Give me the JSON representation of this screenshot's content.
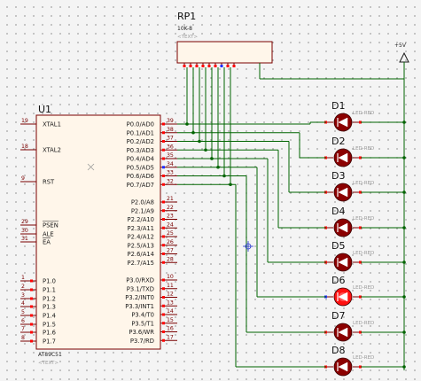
{
  "u1": {
    "ref": "U1",
    "part": "AT89C51",
    "text_placeholder": "<TEXT>",
    "left_pins": [
      {
        "num": "19",
        "label": "XTAL1"
      },
      {
        "num": "18",
        "label": "XTAL2"
      },
      {
        "num": "9",
        "label": "RST"
      },
      {
        "num": "29",
        "label": "PSEN"
      },
      {
        "num": "30",
        "label": "ALE"
      },
      {
        "num": "31",
        "label": "EA"
      },
      {
        "num": "1",
        "label": "P1.0"
      },
      {
        "num": "2",
        "label": "P1.1"
      },
      {
        "num": "3",
        "label": "P1.2"
      },
      {
        "num": "4",
        "label": "P1.3"
      },
      {
        "num": "5",
        "label": "P1.4"
      },
      {
        "num": "6",
        "label": "P1.5"
      },
      {
        "num": "7",
        "label": "P1.6"
      },
      {
        "num": "8",
        "label": "P1.7"
      }
    ],
    "right_pins": [
      {
        "num": "39",
        "label": "P0.0/AD0"
      },
      {
        "num": "38",
        "label": "P0.1/AD1"
      },
      {
        "num": "37",
        "label": "P0.2/AD2"
      },
      {
        "num": "36",
        "label": "P0.3/AD3"
      },
      {
        "num": "35",
        "label": "P0.4/AD4"
      },
      {
        "num": "34",
        "label": "P0.5/AD5"
      },
      {
        "num": "33",
        "label": "P0.6/AD6"
      },
      {
        "num": "32",
        "label": "P0.7/AD7"
      },
      {
        "num": "21",
        "label": "P2.0/A8"
      },
      {
        "num": "22",
        "label": "P2.1/A9"
      },
      {
        "num": "23",
        "label": "P2.2/A10"
      },
      {
        "num": "24",
        "label": "P2.3/A11"
      },
      {
        "num": "25",
        "label": "P2.4/A12"
      },
      {
        "num": "26",
        "label": "P2.5/A13"
      },
      {
        "num": "27",
        "label": "P2.6/A14"
      },
      {
        "num": "28",
        "label": "P2.7/A15"
      },
      {
        "num": "10",
        "label": "P3.0/RXD"
      },
      {
        "num": "11",
        "label": "P3.1/TXD"
      },
      {
        "num": "12",
        "label": "P3.2/INT0"
      },
      {
        "num": "13",
        "label": "P3.3/INT1"
      },
      {
        "num": "14",
        "label": "P3.4/T0"
      },
      {
        "num": "15",
        "label": "P3.5/T1"
      },
      {
        "num": "16",
        "label": "P3.6/WR"
      },
      {
        "num": "17",
        "label": "P3.7/RD"
      }
    ]
  },
  "rp1": {
    "ref": "RP1",
    "value": "10K-8",
    "text_placeholder": "<TEXT>"
  },
  "power": {
    "label": "+5V"
  },
  "leds": [
    {
      "ref": "D1",
      "lit": false
    },
    {
      "ref": "D2",
      "lit": false
    },
    {
      "ref": "D3",
      "lit": false
    },
    {
      "ref": "D4",
      "lit": false
    },
    {
      "ref": "D5",
      "lit": false
    },
    {
      "ref": "D6",
      "lit": true
    },
    {
      "ref": "D7",
      "lit": false
    },
    {
      "ref": "D8",
      "lit": false
    }
  ],
  "colors": {
    "wire": "#006400",
    "body_fill": "#fff6ea",
    "body_stroke": "#7a0000",
    "pin_stub": "#7a0000",
    "led_off": "#8b0000",
    "led_on": "#ff1010",
    "pin_state_high": "#ff0000",
    "pin_state_low": "#1e2cff",
    "power_stroke": "#1a1a1a"
  }
}
